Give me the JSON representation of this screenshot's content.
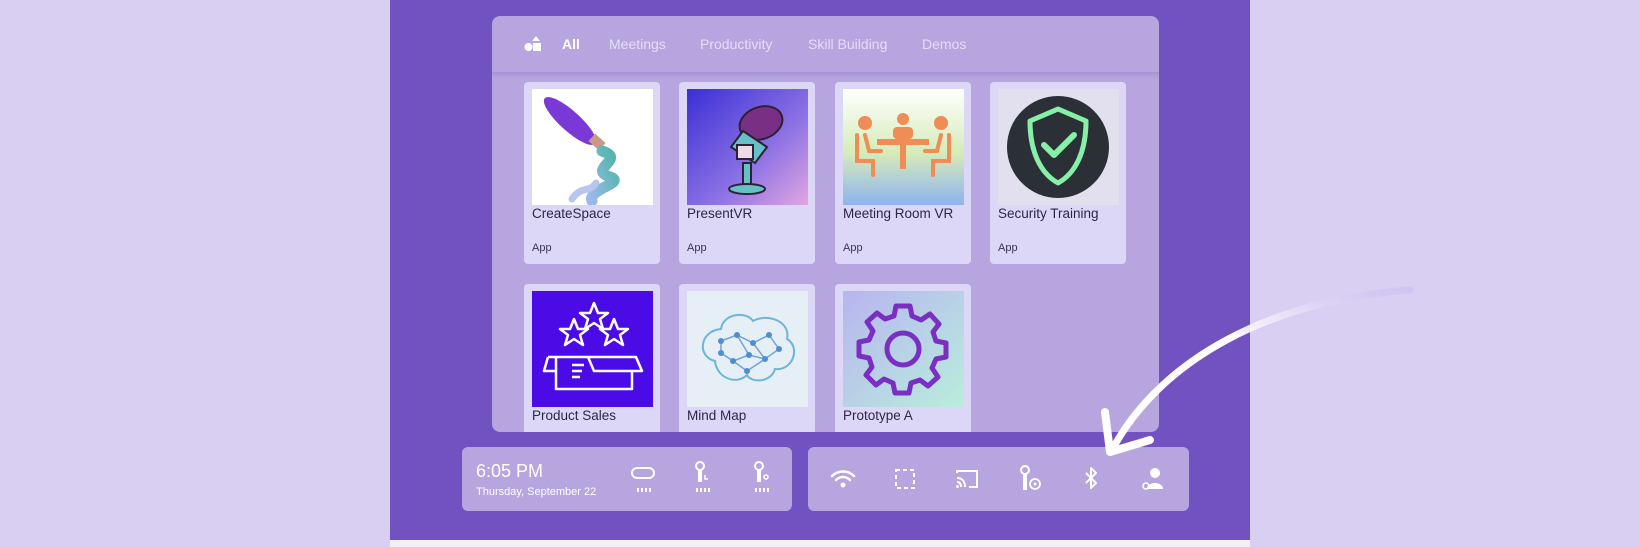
{
  "tabs": [
    {
      "label": "All",
      "active": true
    },
    {
      "label": "Meetings",
      "active": false
    },
    {
      "label": "Productivity",
      "active": false
    },
    {
      "label": "Skill Building",
      "active": false
    },
    {
      "label": "Demos",
      "active": false
    }
  ],
  "apps": [
    {
      "title": "CreateSpace",
      "kind": "App",
      "icon": "paintbrush-icon"
    },
    {
      "title": "PresentVR",
      "kind": "App",
      "icon": "microphone-icon"
    },
    {
      "title": "Meeting Room VR",
      "kind": "App",
      "icon": "meeting-table-icon"
    },
    {
      "title": "Security Training",
      "kind": "App",
      "icon": "shield-check-icon"
    },
    {
      "title": "Product Sales",
      "kind": "",
      "icon": "star-box-icon"
    },
    {
      "title": "Mind Map",
      "kind": "",
      "icon": "brain-icon"
    },
    {
      "title": "Prototype A",
      "kind": "",
      "icon": "gear-icon"
    }
  ],
  "clock": {
    "time": "6:05 PM",
    "date": "Thursday, September 22"
  },
  "devices": [
    "headset-icon",
    "left-controller-icon",
    "right-controller-icon"
  ],
  "quick_settings": [
    "wifi-icon",
    "boundary-icon",
    "cast-icon",
    "controller-sync-icon",
    "bluetooth-icon",
    "account-icon"
  ],
  "colors": {
    "panel": "#7251c0",
    "library": "#b6a5de",
    "card": "#dcd6f7",
    "background": "#d8cff3"
  }
}
